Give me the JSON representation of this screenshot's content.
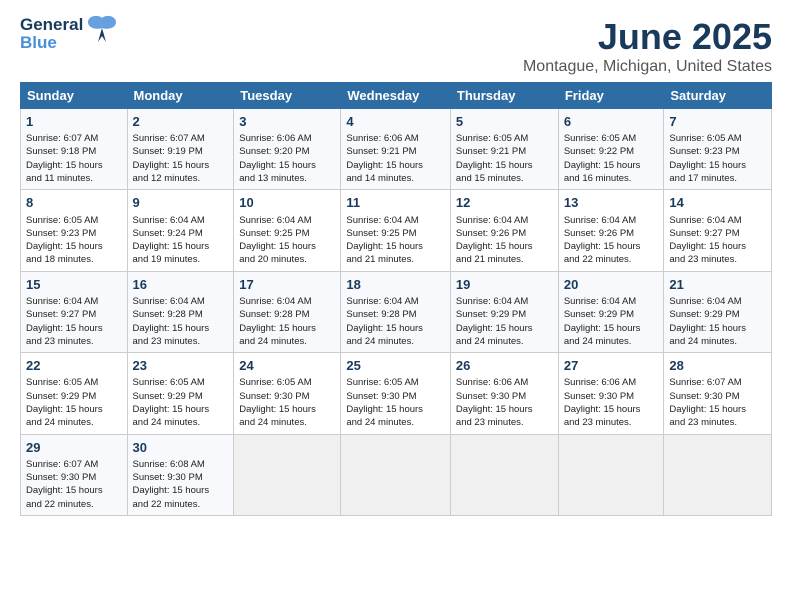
{
  "logo": {
    "line1": "General",
    "line2": "Blue"
  },
  "title": "June 2025",
  "subtitle": "Montague, Michigan, United States",
  "headers": [
    "Sunday",
    "Monday",
    "Tuesday",
    "Wednesday",
    "Thursday",
    "Friday",
    "Saturday"
  ],
  "weeks": [
    [
      {
        "day": "1",
        "info": "Sunrise: 6:07 AM\nSunset: 9:18 PM\nDaylight: 15 hours\nand 11 minutes."
      },
      {
        "day": "2",
        "info": "Sunrise: 6:07 AM\nSunset: 9:19 PM\nDaylight: 15 hours\nand 12 minutes."
      },
      {
        "day": "3",
        "info": "Sunrise: 6:06 AM\nSunset: 9:20 PM\nDaylight: 15 hours\nand 13 minutes."
      },
      {
        "day": "4",
        "info": "Sunrise: 6:06 AM\nSunset: 9:21 PM\nDaylight: 15 hours\nand 14 minutes."
      },
      {
        "day": "5",
        "info": "Sunrise: 6:05 AM\nSunset: 9:21 PM\nDaylight: 15 hours\nand 15 minutes."
      },
      {
        "day": "6",
        "info": "Sunrise: 6:05 AM\nSunset: 9:22 PM\nDaylight: 15 hours\nand 16 minutes."
      },
      {
        "day": "7",
        "info": "Sunrise: 6:05 AM\nSunset: 9:23 PM\nDaylight: 15 hours\nand 17 minutes."
      }
    ],
    [
      {
        "day": "8",
        "info": "Sunrise: 6:05 AM\nSunset: 9:23 PM\nDaylight: 15 hours\nand 18 minutes."
      },
      {
        "day": "9",
        "info": "Sunrise: 6:04 AM\nSunset: 9:24 PM\nDaylight: 15 hours\nand 19 minutes."
      },
      {
        "day": "10",
        "info": "Sunrise: 6:04 AM\nSunset: 9:25 PM\nDaylight: 15 hours\nand 20 minutes."
      },
      {
        "day": "11",
        "info": "Sunrise: 6:04 AM\nSunset: 9:25 PM\nDaylight: 15 hours\nand 21 minutes."
      },
      {
        "day": "12",
        "info": "Sunrise: 6:04 AM\nSunset: 9:26 PM\nDaylight: 15 hours\nand 21 minutes."
      },
      {
        "day": "13",
        "info": "Sunrise: 6:04 AM\nSunset: 9:26 PM\nDaylight: 15 hours\nand 22 minutes."
      },
      {
        "day": "14",
        "info": "Sunrise: 6:04 AM\nSunset: 9:27 PM\nDaylight: 15 hours\nand 23 minutes."
      }
    ],
    [
      {
        "day": "15",
        "info": "Sunrise: 6:04 AM\nSunset: 9:27 PM\nDaylight: 15 hours\nand 23 minutes."
      },
      {
        "day": "16",
        "info": "Sunrise: 6:04 AM\nSunset: 9:28 PM\nDaylight: 15 hours\nand 23 minutes."
      },
      {
        "day": "17",
        "info": "Sunrise: 6:04 AM\nSunset: 9:28 PM\nDaylight: 15 hours\nand 24 minutes."
      },
      {
        "day": "18",
        "info": "Sunrise: 6:04 AM\nSunset: 9:28 PM\nDaylight: 15 hours\nand 24 minutes."
      },
      {
        "day": "19",
        "info": "Sunrise: 6:04 AM\nSunset: 9:29 PM\nDaylight: 15 hours\nand 24 minutes."
      },
      {
        "day": "20",
        "info": "Sunrise: 6:04 AM\nSunset: 9:29 PM\nDaylight: 15 hours\nand 24 minutes."
      },
      {
        "day": "21",
        "info": "Sunrise: 6:04 AM\nSunset: 9:29 PM\nDaylight: 15 hours\nand 24 minutes."
      }
    ],
    [
      {
        "day": "22",
        "info": "Sunrise: 6:05 AM\nSunset: 9:29 PM\nDaylight: 15 hours\nand 24 minutes."
      },
      {
        "day": "23",
        "info": "Sunrise: 6:05 AM\nSunset: 9:29 PM\nDaylight: 15 hours\nand 24 minutes."
      },
      {
        "day": "24",
        "info": "Sunrise: 6:05 AM\nSunset: 9:30 PM\nDaylight: 15 hours\nand 24 minutes."
      },
      {
        "day": "25",
        "info": "Sunrise: 6:05 AM\nSunset: 9:30 PM\nDaylight: 15 hours\nand 24 minutes."
      },
      {
        "day": "26",
        "info": "Sunrise: 6:06 AM\nSunset: 9:30 PM\nDaylight: 15 hours\nand 23 minutes."
      },
      {
        "day": "27",
        "info": "Sunrise: 6:06 AM\nSunset: 9:30 PM\nDaylight: 15 hours\nand 23 minutes."
      },
      {
        "day": "28",
        "info": "Sunrise: 6:07 AM\nSunset: 9:30 PM\nDaylight: 15 hours\nand 23 minutes."
      }
    ],
    [
      {
        "day": "29",
        "info": "Sunrise: 6:07 AM\nSunset: 9:30 PM\nDaylight: 15 hours\nand 22 minutes."
      },
      {
        "day": "30",
        "info": "Sunrise: 6:08 AM\nSunset: 9:30 PM\nDaylight: 15 hours\nand 22 minutes."
      },
      {
        "day": "",
        "info": ""
      },
      {
        "day": "",
        "info": ""
      },
      {
        "day": "",
        "info": ""
      },
      {
        "day": "",
        "info": ""
      },
      {
        "day": "",
        "info": ""
      }
    ]
  ]
}
